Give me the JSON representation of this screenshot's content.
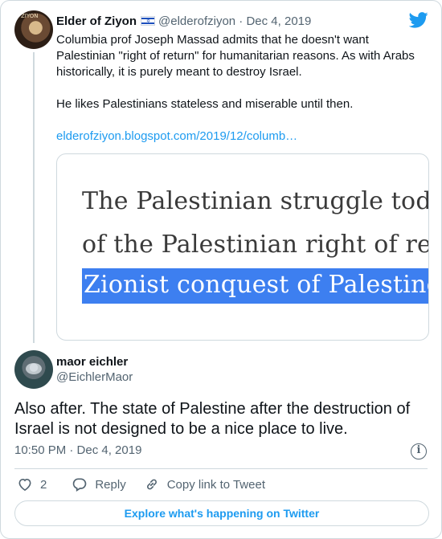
{
  "parent_tweet": {
    "display_name": "Elder of Ziyon",
    "handle": "@elderofziyon",
    "separator": "·",
    "date": "Dec 4, 2019",
    "avatar_label": "ZIYON",
    "text_line1": "Columbia prof Joseph Massad admits that he doesn't want Palestinian \"right of return\" for humanitarian reasons. As with Arabs historically, it is purely meant to destroy Israel.",
    "text_line2": "He likes Palestinians stateless and miserable until then.",
    "link": "elderofziyon.blogspot.com/2019/12/columb…",
    "media_lines": [
      "The Palestinian struggle toda",
      "of the Palestinian right of ret",
      "Zionist conquest of Palestine"
    ]
  },
  "reply_tweet": {
    "display_name": "maor eichler",
    "handle": "@EichlerMaor",
    "text": "Also after. The state of Palestine after the destruction of Israel is not designed to be a nice place to live.",
    "timestamp": "10:50 PM · Dec 4, 2019",
    "info_symbol": "i",
    "likes_count": "2",
    "reply_label": "Reply",
    "copy_link_label": "Copy link to Tweet",
    "explore_label": "Explore what's happening on Twitter"
  },
  "colors": {
    "accent": "#1d9bf0",
    "text": "#0f1419",
    "muted": "#536471",
    "border": "#cfd9de",
    "highlight": "#3d7ff0"
  },
  "icons": {
    "brand": "twitter-bird-icon",
    "like": "heart-icon",
    "reply": "speech-bubble-icon",
    "copy_link": "link-icon",
    "info": "info-icon",
    "flag": "israel-flag-icon"
  }
}
